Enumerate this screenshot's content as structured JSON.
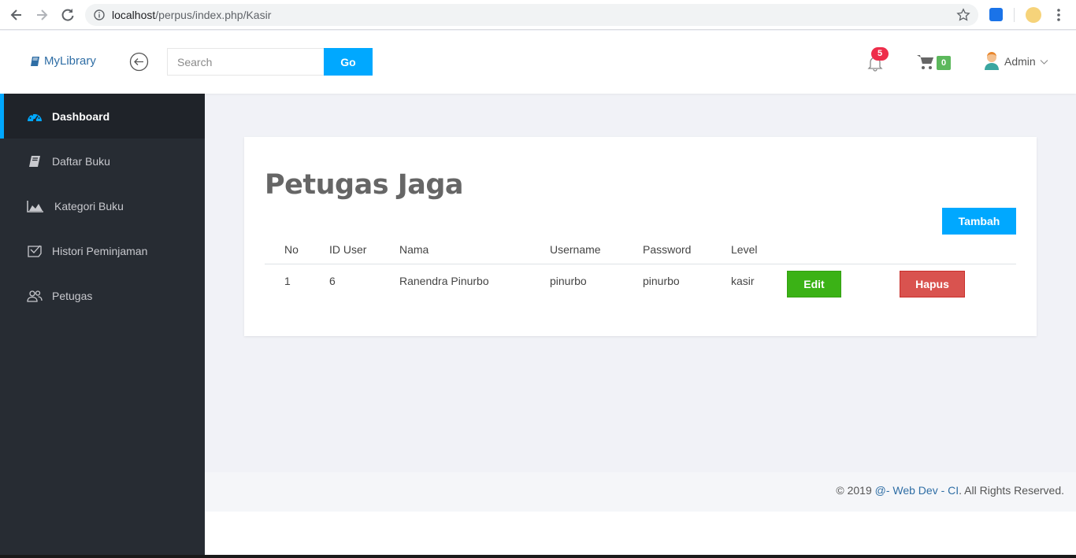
{
  "browser": {
    "url_host": "localhost",
    "url_path": "/perpus/index.php/Kasir"
  },
  "header": {
    "brand": "MyLibrary",
    "search_placeholder": "Search",
    "search_button": "Go",
    "notification_count": "5",
    "cart_count": "0",
    "user_name": "Admin"
  },
  "sidebar": {
    "items": [
      {
        "label": "Dashboard",
        "icon": "dashboard-icon"
      },
      {
        "label": "Daftar Buku",
        "icon": "book-icon"
      },
      {
        "label": "Kategori Buku",
        "icon": "area-chart-icon"
      },
      {
        "label": "Histori Peminjaman",
        "icon": "history-icon"
      },
      {
        "label": "Petugas",
        "icon": "users-icon"
      }
    ]
  },
  "main": {
    "title": "Petugas Jaga",
    "add_button": "Tambah",
    "table": {
      "columns": [
        "No",
        "ID User",
        "Nama",
        "Username",
        "Password",
        "Level"
      ],
      "rows": [
        {
          "no": "1",
          "id_user": "6",
          "nama": "Ranendra Pinurbo",
          "username": "pinurbo",
          "password": "pinurbo",
          "level": "kasir",
          "edit": "Edit",
          "delete": "Hapus"
        }
      ]
    }
  },
  "footer": {
    "prefix": "© 2019 ",
    "link": "@- Web Dev - CI",
    "suffix": ". All Rights Reserved."
  },
  "colors": {
    "accent": "#00a8ff",
    "sidebar_bg": "#272c33",
    "edit_green": "#3bb216",
    "delete_red": "#d9534f",
    "notif_red": "#ee2d4a",
    "cart_green": "#5cb85c"
  }
}
